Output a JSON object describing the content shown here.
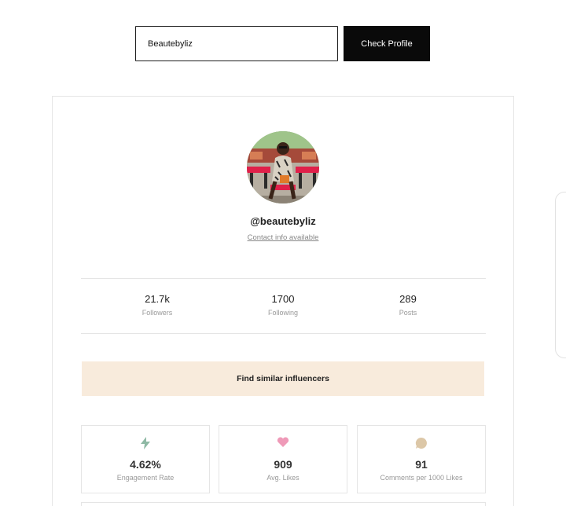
{
  "search": {
    "value": "Beautebyliz",
    "button_label": "Check Profile"
  },
  "profile": {
    "handle": "@beautebyliz",
    "contact_link": "Contact info available"
  },
  "stats": [
    {
      "value": "21.7k",
      "label": "Followers"
    },
    {
      "value": "1700",
      "label": "Following"
    },
    {
      "value": "289",
      "label": "Posts"
    }
  ],
  "similar_button": "Find similar influencers",
  "metrics": [
    {
      "icon": "lightning-icon",
      "value": "4.62%",
      "label": "Engagement Rate",
      "color": "#8fb9a5"
    },
    {
      "icon": "heart-icon",
      "value": "909",
      "label": "Avg. Likes",
      "color": "#ef9ab8"
    },
    {
      "icon": "comment-icon",
      "value": "91",
      "label": "Comments per 1000 Likes",
      "color": "#dcc7a7"
    }
  ],
  "colors": {
    "button_bg": "#0a0a0a",
    "similar_bg": "#f8ebdc",
    "border": "#e5e5e5"
  }
}
